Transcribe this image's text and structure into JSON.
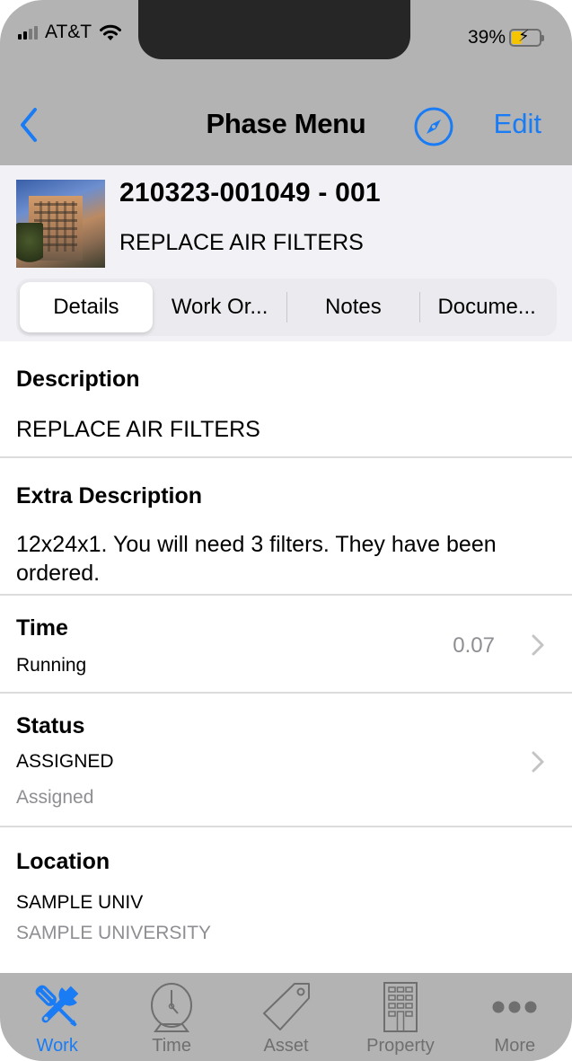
{
  "status_bar": {
    "carrier": "AT&T",
    "battery_percent_label": "39%",
    "battery_level": 0.39,
    "charging": true
  },
  "nav": {
    "title": "Phase Menu",
    "back_icon": "chevron-left-icon",
    "compass_icon": "compass-icon",
    "edit_label": "Edit"
  },
  "work_order": {
    "number": "210323-001049 - 001",
    "title": "REPLACE AIR FILTERS",
    "thumbnail": "building-photo"
  },
  "tabs": [
    {
      "label": "Details",
      "active": true
    },
    {
      "label": "Work Or...",
      "active": false
    },
    {
      "label": "Notes",
      "active": false
    },
    {
      "label": "Docume...",
      "active": false
    }
  ],
  "details": {
    "description": {
      "label": "Description",
      "value": "REPLACE AIR FILTERS"
    },
    "extra_description": {
      "label": "Extra Description",
      "value": "12x24x1.  You will need 3 filters.  They have been ordered."
    },
    "time": {
      "label": "Time",
      "sub": "Running",
      "value": "0.07"
    },
    "status": {
      "label": "Status",
      "code": "ASSIGNED",
      "description": "Assigned"
    },
    "location": {
      "label": "Location",
      "code": "SAMPLE UNIV",
      "description": "SAMPLE UNIVERSITY"
    }
  },
  "colors": {
    "accent": "#1a7cf5",
    "bar_background": "#b3b3b3",
    "secondary_text": "#8e8e93",
    "battery_fill": "#f5c400"
  },
  "tabbar": [
    {
      "label": "Work",
      "icon": "wrench-screwdriver-icon",
      "active": true
    },
    {
      "label": "Time",
      "icon": "clock-icon",
      "active": false
    },
    {
      "label": "Asset",
      "icon": "tag-icon",
      "active": false
    },
    {
      "label": "Property",
      "icon": "building-icon",
      "active": false
    },
    {
      "label": "More",
      "icon": "more-dots-icon",
      "active": false
    }
  ]
}
